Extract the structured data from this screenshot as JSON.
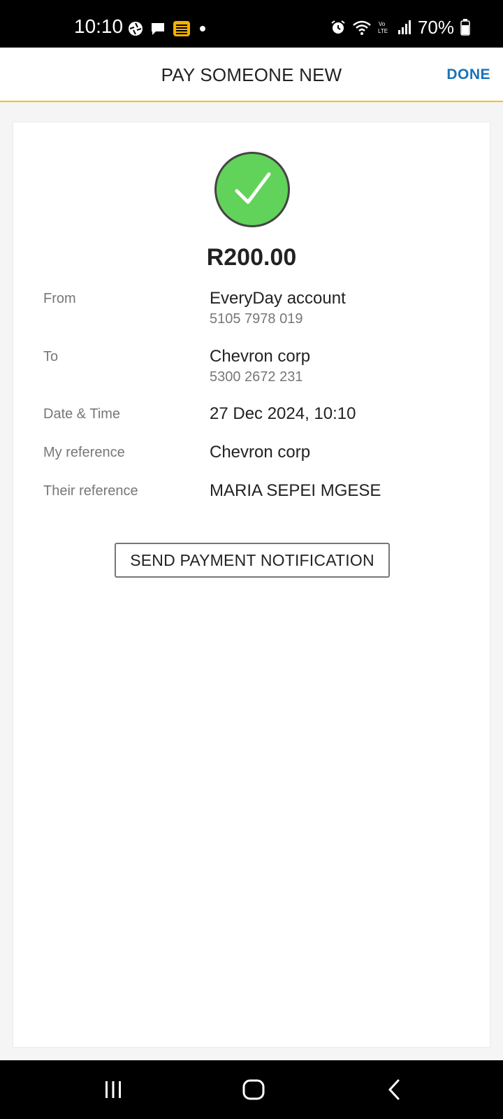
{
  "status_bar": {
    "time": "10:10",
    "battery": "70%",
    "left_icons": [
      "aperture-icon",
      "chat-bubble-icon",
      "bank-app-icon",
      "dot-icon"
    ],
    "right_icons": [
      "alarm-icon",
      "wifi-icon",
      "volte-icon",
      "signal-icon",
      "battery-icon"
    ]
  },
  "header": {
    "title": "PAY SOMEONE NEW",
    "done_label": "DONE"
  },
  "receipt": {
    "status_icon": "checkmark-icon",
    "amount": "R200.00",
    "from_label": "From",
    "from_value": "EveryDay account",
    "from_account": "5105 7978 019",
    "to_label": "To",
    "to_value": "Chevron corp",
    "to_account": "5300 2672 231",
    "datetime_label": "Date & Time",
    "datetime_value": "27 Dec 2024, 10:10",
    "my_ref_label": "My reference",
    "my_ref_value": "Chevron corp",
    "their_ref_label": "Their reference",
    "their_ref_value": "MARIA SEPEI MGESE",
    "notify_button": "SEND PAYMENT NOTIFICATION"
  },
  "nav": {
    "icons": [
      "recent-apps-icon",
      "home-icon",
      "back-icon"
    ]
  },
  "colors": {
    "accent": "#f2c300",
    "link": "#1a73b8",
    "success": "#61d35a"
  }
}
